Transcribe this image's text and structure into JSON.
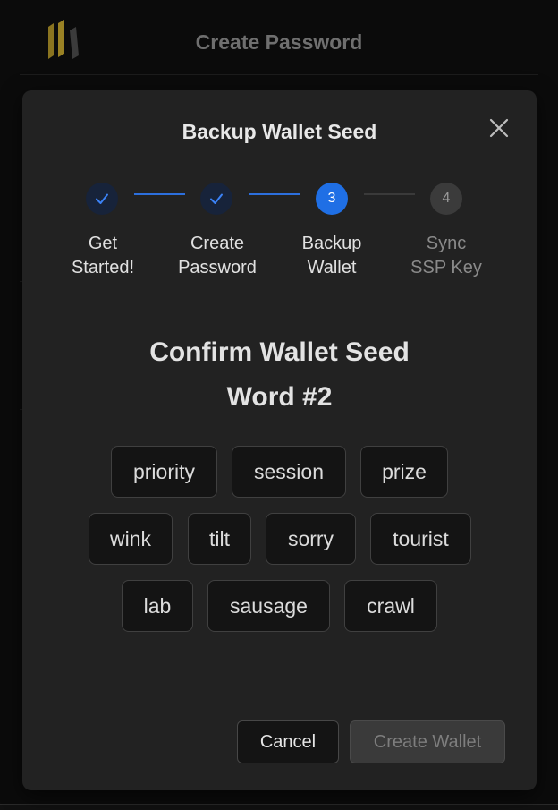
{
  "background": {
    "header_title": "Create Password",
    "logo_icon": "ssp-logo-icon"
  },
  "modal": {
    "title": "Backup Wallet Seed",
    "close_icon": "close-icon",
    "steps": [
      {
        "number": "1",
        "label_line1": "Get",
        "label_line2": "Started!",
        "state": "done"
      },
      {
        "number": "2",
        "label_line1": "Create",
        "label_line2": "Password",
        "state": "done"
      },
      {
        "number": "3",
        "label_line1": "Backup",
        "label_line2": "Wallet",
        "state": "active"
      },
      {
        "number": "4",
        "label_line1": "Sync",
        "label_line2": "SSP Key",
        "state": "pending"
      }
    ],
    "confirm_heading_line1": "Confirm Wallet Seed",
    "confirm_heading_line2": "Word #2",
    "word_rows": [
      [
        "priority",
        "session",
        "prize"
      ],
      [
        "wink",
        "tilt",
        "sorry",
        "tourist"
      ],
      [
        "lab",
        "sausage",
        "crawl"
      ]
    ],
    "cancel_label": "Cancel",
    "create_label": "Create Wallet"
  },
  "colors": {
    "accent": "#1f6fe5",
    "modal_bg": "#222222",
    "page_bg": "#0b0b0b"
  }
}
